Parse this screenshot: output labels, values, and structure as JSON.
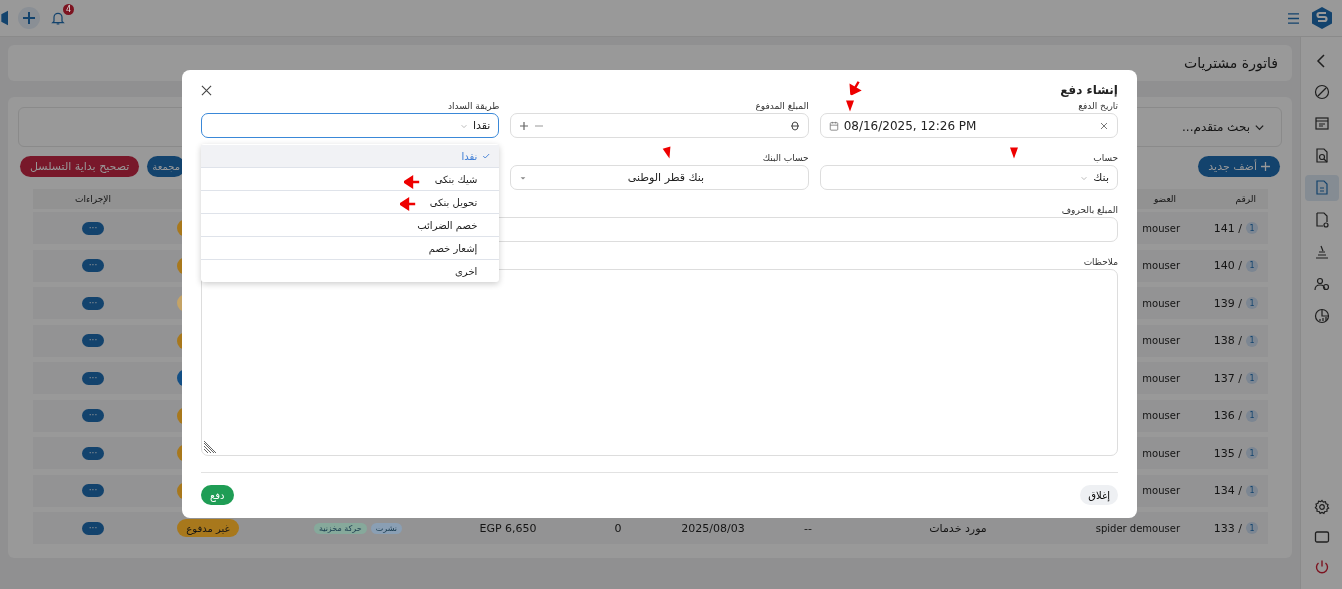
{
  "top_bar": {
    "notification_count": "4"
  },
  "sidebar": {
    "items": [
      {
        "selected": false
      },
      {
        "selected": false
      },
      {
        "selected": false
      },
      {
        "selected": true
      },
      {
        "selected": false
      },
      {
        "selected": false
      },
      {
        "selected": false
      },
      {
        "selected": false
      }
    ]
  },
  "page_title": "فاتورة مشتريات",
  "search": {
    "label": "بحث متقدم..."
  },
  "toolbar": {
    "add_button": "أضف جديد",
    "bulk_button": "مجمعة",
    "fix_sequence_button": "تصحيح بداية التسلسل"
  },
  "table": {
    "headers": {
      "number": "الرقم",
      "member": "العضو",
      "actions": "الإجراءات"
    },
    "rows": [
      {
        "badge": "1",
        "number": "141 /",
        "member": "mouser",
        "color": "#a8781c",
        "actions": "···"
      },
      {
        "badge": "1",
        "number": "140 /",
        "member": "mouser",
        "color": "#a8781c",
        "actions": "···"
      },
      {
        "badge": "1",
        "number": "139 /",
        "member": "mouser",
        "color": "#c4a366",
        "actions": "···"
      },
      {
        "badge": "1",
        "number": "138 /",
        "member": "mouser",
        "color": "#a8781c",
        "actions": "···"
      },
      {
        "badge": "1",
        "number": "137 /",
        "member": "mouser",
        "color": "#134f85",
        "actions": "···"
      },
      {
        "badge": "1",
        "number": "136 /",
        "member": "mouser",
        "color": "#a8781c",
        "actions": "···"
      },
      {
        "badge": "1",
        "number": "135 /",
        "member": "mouser",
        "color": "#a8781c",
        "actions": "···"
      },
      {
        "badge": "1",
        "number": "134 /",
        "member": "mouser",
        "color": "#a8781c",
        "actions": "···"
      },
      {
        "badge": "1",
        "number": "133 /",
        "member": "spider demouser",
        "type": "مورد خدمات",
        "column_4": "--",
        "date": "2025/08/03",
        "column_6": "0",
        "amount": "EGP 6,650",
        "tags": [
          {
            "label": "نشرت",
            "color": "#8a9fb4"
          },
          {
            "label": "حركة مخزنية",
            "color": "#86a99b"
          }
        ],
        "status": "غير مدفوع",
        "color": "#a8781c",
        "actions": "···"
      }
    ]
  },
  "dialog": {
    "title": "إنشاء دفع",
    "fields": [
      {
        "kind": "date",
        "label": "تاريخ الدفع",
        "value": "08/16/2025, 12:26 PM",
        "focused": false
      },
      {
        "kind": "number",
        "label": "المبلغ المدفوع",
        "focused": false
      },
      {
        "kind": "select",
        "label": "طريقة السداد",
        "value": "نقدا",
        "focused": true
      },
      {
        "kind": "select",
        "label": "حساب",
        "value": "بنك",
        "focused": false
      },
      {
        "kind": "dropdown",
        "label": "حساب البنك",
        "value": "بنك قطر الوطنى",
        "focused": false
      },
      {
        "kind": "text",
        "label": "المبلغ بالحروف",
        "focused": false
      },
      {
        "kind": "textarea",
        "label": "ملاحظات",
        "focused": false
      }
    ],
    "menu": [
      {
        "label": "نقدا",
        "selected": true
      },
      {
        "label": "شيك بنكى",
        "selected": false
      },
      {
        "label": "تحويل بنكى",
        "selected": false
      },
      {
        "label": "خصم الضرائب",
        "selected": false
      },
      {
        "label": "إشعار خصم",
        "selected": false
      },
      {
        "label": "اخرى",
        "selected": false
      }
    ],
    "close_button": "إغلاق",
    "pay_button": "دفع"
  }
}
